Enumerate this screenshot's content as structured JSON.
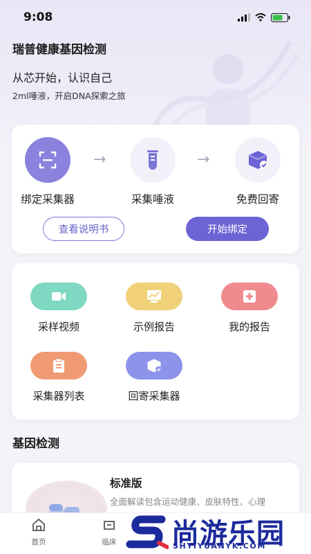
{
  "status_bar": {
    "time": "9:08"
  },
  "header": {
    "title": "瑞普健康基因检测",
    "tagline": "从芯开始，认识自己",
    "subline": "2ml唾液，开启DNA探索之旅"
  },
  "steps": [
    {
      "label": "绑定采集器",
      "icon": "scan-icon"
    },
    {
      "label": "采集唾液",
      "icon": "test-tube-icon"
    },
    {
      "label": "免费回寄",
      "icon": "box-check-icon"
    }
  ],
  "buttons": {
    "manual": "查看说明书",
    "bind": "开始绑定"
  },
  "tiles": [
    {
      "label": "采样视频",
      "icon": "video-icon",
      "color": "#7fd8c1"
    },
    {
      "label": "示例报告",
      "icon": "chart-icon",
      "color": "#f1d07a"
    },
    {
      "label": "我的报告",
      "icon": "medical-plus-icon",
      "color": "#ef8a8e"
    },
    {
      "label": "采集器列表",
      "icon": "clipboard-icon",
      "color": "#f09a74"
    },
    {
      "label": "回寄采集器",
      "icon": "box-check-icon",
      "color": "#8d93ea"
    }
  ],
  "section": {
    "title": "基因检测"
  },
  "product": {
    "name": "标准版",
    "description": "全面解读包含运动健康、皮肤特性、心理"
  },
  "tabbar": [
    {
      "label": "首页",
      "icon": "home-icon"
    },
    {
      "label": "临床",
      "icon": "clinic-icon"
    }
  ],
  "watermark": {
    "text": "尚游乐园",
    "url": "SHYIYUANYK.COM"
  },
  "colors": {
    "accent": "#6c63d4",
    "hero_bg": "#ebe8f7",
    "page_bg": "#f4f3f8"
  }
}
